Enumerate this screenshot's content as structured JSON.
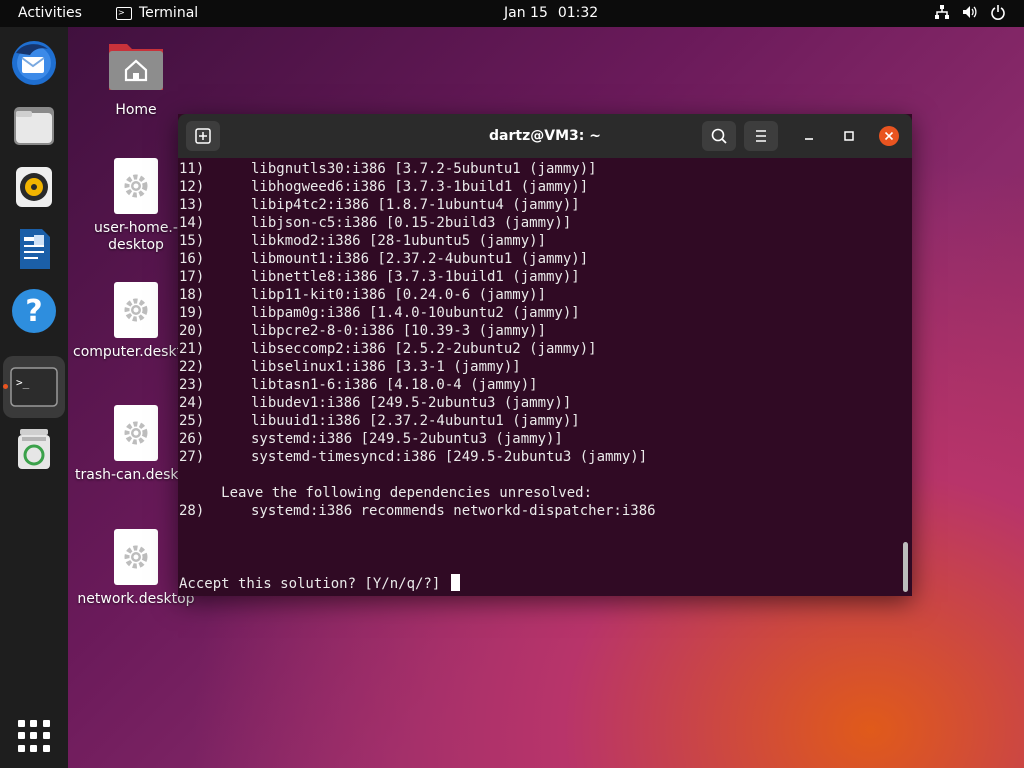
{
  "topbar": {
    "activities": "Activities",
    "app_name": "Terminal",
    "date": "Jan 15",
    "time": "01:32",
    "icons": [
      "network-icon",
      "volume-icon",
      "power-icon"
    ]
  },
  "dock": {
    "items": [
      {
        "name": "thunderbird-icon"
      },
      {
        "name": "files-icon"
      },
      {
        "name": "rhythmbox-icon"
      },
      {
        "name": "writer-icon"
      },
      {
        "name": "help-icon",
        "glyph": "?"
      },
      {
        "name": "terminal-icon",
        "glyph": ">_",
        "active": true
      },
      {
        "name": "trash-icon"
      }
    ],
    "apps_grid": "show-apps-icon"
  },
  "desktop": {
    "icons": [
      {
        "label": "Home"
      },
      {
        "label": "user-home.-\ndesktop"
      },
      {
        "label": "computer.deskt"
      },
      {
        "label": "trash-can.deskt"
      },
      {
        "label": "network.desktop"
      }
    ]
  },
  "terminal": {
    "title": "dartz@VM3: ~",
    "lines": [
      {
        "num": "11)",
        "text": "libgnutls30:i386 [3.7.2-5ubuntu1 (jammy)]"
      },
      {
        "num": "12)",
        "text": "libhogweed6:i386 [3.7.3-1build1 (jammy)]"
      },
      {
        "num": "13)",
        "text": "libip4tc2:i386 [1.8.7-1ubuntu4 (jammy)]"
      },
      {
        "num": "14)",
        "text": "libjson-c5:i386 [0.15-2build3 (jammy)]"
      },
      {
        "num": "15)",
        "text": "libkmod2:i386 [28-1ubuntu5 (jammy)]"
      },
      {
        "num": "16)",
        "text": "libmount1:i386 [2.37.2-4ubuntu1 (jammy)]"
      },
      {
        "num": "17)",
        "text": "libnettle8:i386 [3.7.3-1build1 (jammy)]"
      },
      {
        "num": "18)",
        "text": "libp11-kit0:i386 [0.24.0-6 (jammy)]"
      },
      {
        "num": "19)",
        "text": "libpam0g:i386 [1.4.0-10ubuntu2 (jammy)]"
      },
      {
        "num": "20)",
        "text": "libpcre2-8-0:i386 [10.39-3 (jammy)]"
      },
      {
        "num": "21)",
        "text": "libseccomp2:i386 [2.5.2-2ubuntu2 (jammy)]"
      },
      {
        "num": "22)",
        "text": "libselinux1:i386 [3.3-1 (jammy)]"
      },
      {
        "num": "23)",
        "text": "libtasn1-6:i386 [4.18.0-4 (jammy)]"
      },
      {
        "num": "24)",
        "text": "libudev1:i386 [249.5-2ubuntu3 (jammy)]"
      },
      {
        "num": "25)",
        "text": "libuuid1:i386 [2.37.2-4ubuntu1 (jammy)]"
      },
      {
        "num": "26)",
        "text": "systemd:i386 [249.5-2ubuntu3 (jammy)]"
      },
      {
        "num": "27)",
        "text": "systemd-timesyncd:i386 [249.5-2ubuntu3 (jammy)]"
      }
    ],
    "unresolved_heading": "     Leave the following dependencies unresolved:",
    "unresolved_line": {
      "num": "28)",
      "text": "systemd:i386 recommends networkd-dispatcher:i386"
    },
    "prompt": "Accept this solution? [Y/n/q/?] "
  },
  "colors": {
    "terminal_bg": "#300a24",
    "accent": "#e95420",
    "close_button": "#e95420"
  }
}
